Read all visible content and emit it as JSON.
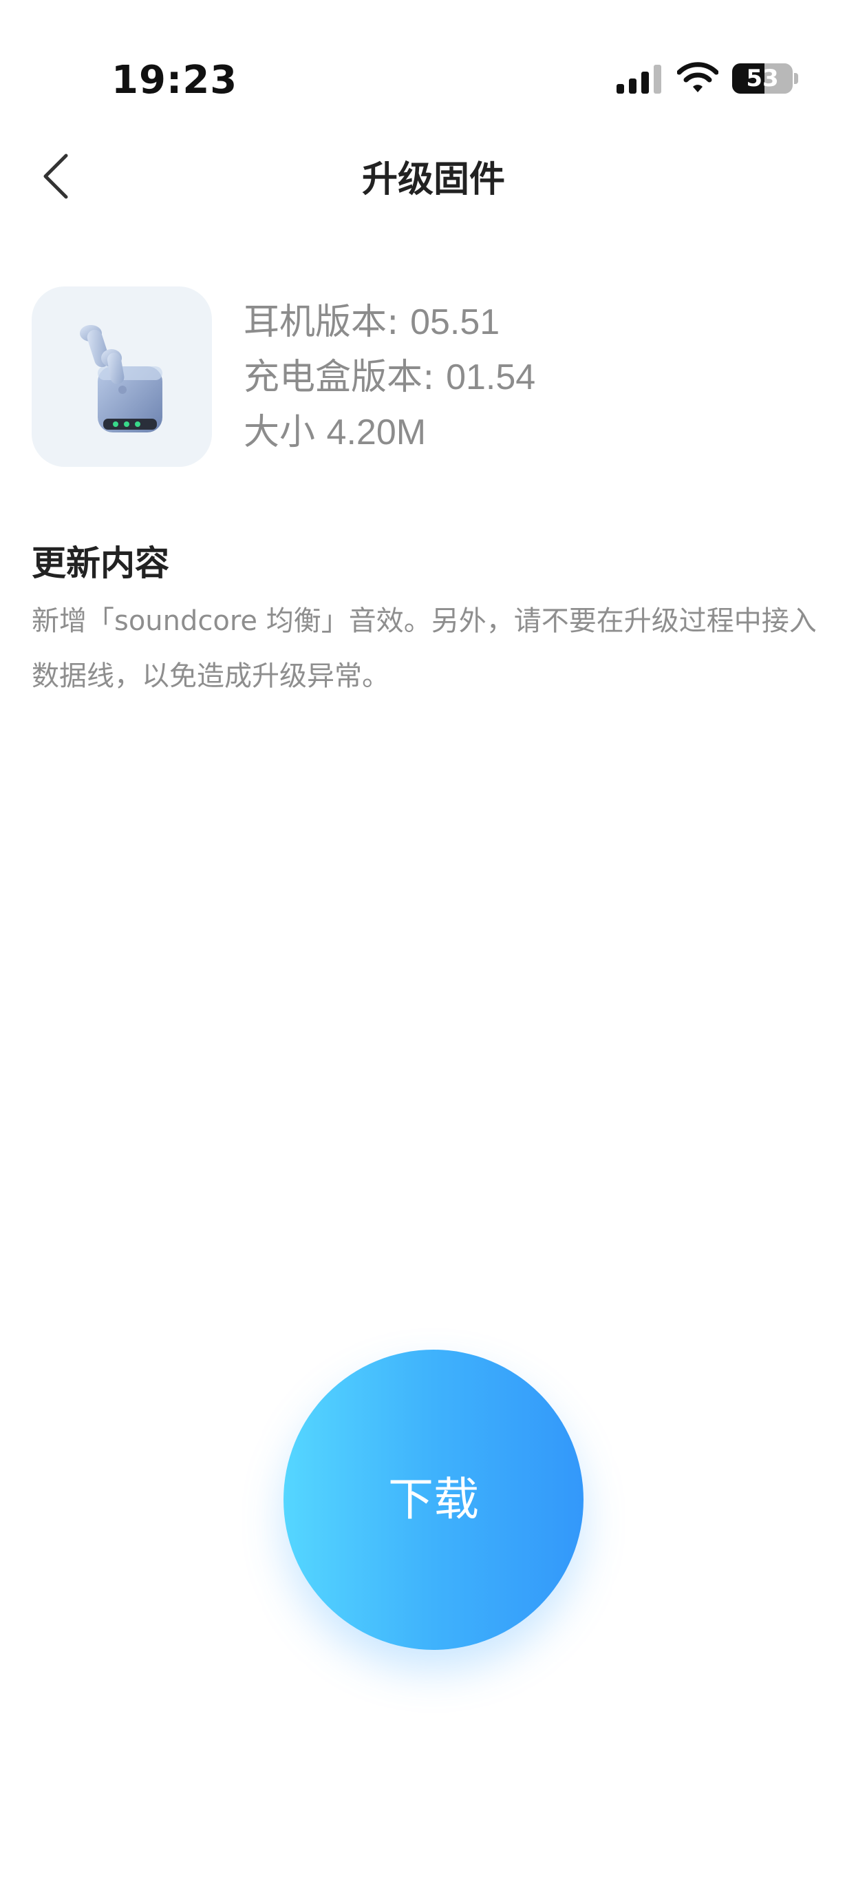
{
  "status_bar": {
    "time": "19:23",
    "battery_percent": "53",
    "icons": [
      "signal-icon",
      "wifi-icon",
      "battery-icon"
    ]
  },
  "nav": {
    "back_icon": "chevron-left-icon",
    "title": "升级固件"
  },
  "device": {
    "image_icon": "earbuds-case-icon",
    "earbuds_version_label": "耳机版本:",
    "earbuds_version_value": "05.51",
    "case_version_label": "充电盒版本:",
    "case_version_value": "01.54",
    "size_label": "大小",
    "size_value": "4.20M"
  },
  "update": {
    "title": "更新内容",
    "body": "新增「soundcore 均衡」音效。另外，请不要在升级过程中接入数据线，以免造成升级异常。"
  },
  "download_button": {
    "label": "下载"
  },
  "colors": {
    "button_gradient_start": "#55d6ff",
    "button_gradient_end": "#3398fa",
    "secondary_text": "#8c8c8c",
    "primary_text": "#222222"
  }
}
